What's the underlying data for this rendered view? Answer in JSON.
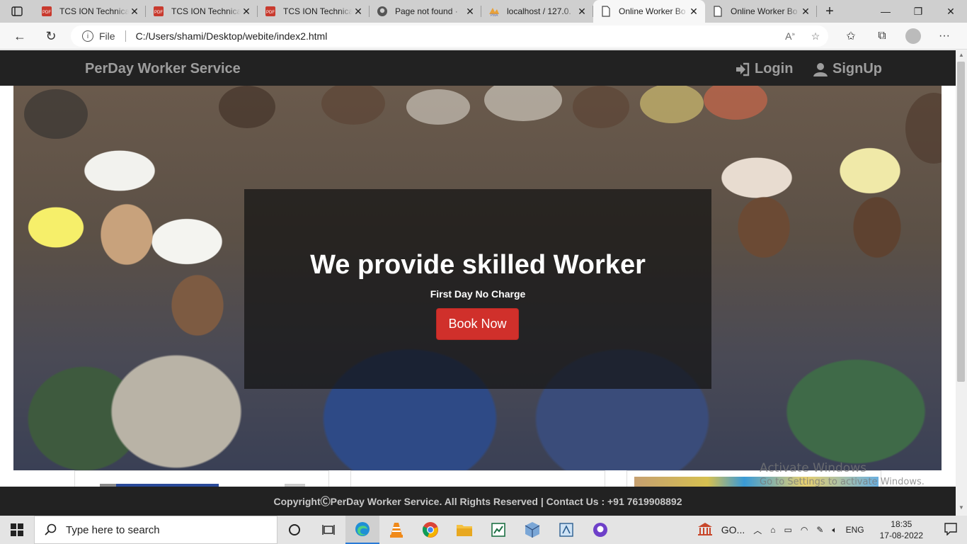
{
  "browser": {
    "tabs": [
      {
        "title": "TCS ION Technica",
        "icon": "pdf-icon"
      },
      {
        "title": "TCS ION Technica",
        "icon": "pdf-icon"
      },
      {
        "title": "TCS ION Technica",
        "icon": "pdf-icon"
      },
      {
        "title": "Page not found ·",
        "icon": "github-icon"
      },
      {
        "title": "localhost / 127.0.",
        "icon": "phpmyadmin-icon"
      },
      {
        "title": "Online Worker Bo",
        "icon": "page-icon",
        "active": true
      },
      {
        "title": "Online Worker Bo",
        "icon": "page-icon"
      }
    ],
    "address": {
      "scheme_label": "File",
      "url": "C:/Users/shami/Desktop/webite/index2.html"
    }
  },
  "site": {
    "brand": "PerDay Worker Service",
    "nav": {
      "login": "Login",
      "signup": "SignUp"
    },
    "hero": {
      "title": "We provide skilled Worker",
      "subtitle": "First Day No Charge",
      "button": "Book Now"
    },
    "footer": "CopyrightⒸPerDay Worker Service. All Rights Reserved | Contact Us : +91 7619908892"
  },
  "watermark": {
    "line1": "Activate Windows",
    "line2": "Go to Settings to activate Windows."
  },
  "taskbar": {
    "search_placeholder": "Type here to search",
    "tray_app": "GO...",
    "language": "ENG",
    "time": "18:35",
    "date": "17-08-2022"
  },
  "colors": {
    "navbar": "#222222",
    "nav_text": "#9d9d9d",
    "button": "#d0302b"
  }
}
